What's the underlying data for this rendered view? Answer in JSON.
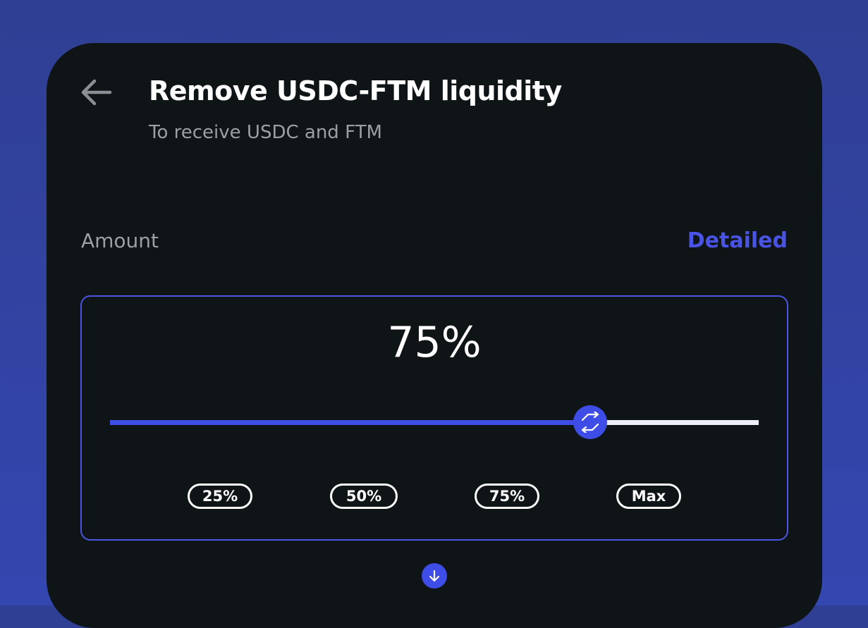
{
  "header": {
    "back_icon": "arrow-left-icon",
    "title": "Remove USDC-FTM liquidity",
    "subtitle": "To receive USDC and FTM"
  },
  "amount": {
    "label": "Amount",
    "detailed_link": "Detailed",
    "percent_display": "75%",
    "slider_fraction": 0.74,
    "presets": [
      "25%",
      "50%",
      "75%",
      "Max"
    ]
  },
  "direction_icon": "arrow-down-icon",
  "slider_thumb_icon": "swap-arrows-icon",
  "colors": {
    "accent": "#3e4de6",
    "panel_bg": "#0f1416",
    "page_bg": "#3042a0",
    "muted_text": "#9aa0a6"
  }
}
